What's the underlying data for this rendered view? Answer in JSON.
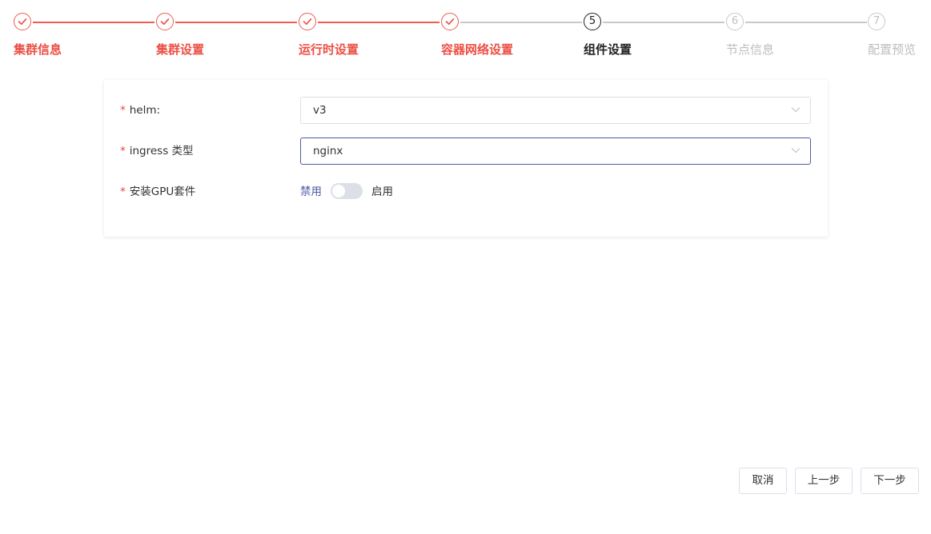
{
  "steps": [
    {
      "number": "1",
      "label": "集群信息",
      "state": "done"
    },
    {
      "number": "2",
      "label": "集群设置",
      "state": "done"
    },
    {
      "number": "3",
      "label": "运行时设置",
      "state": "done"
    },
    {
      "number": "4",
      "label": "容器网络设置",
      "state": "done"
    },
    {
      "number": "5",
      "label": "组件设置",
      "state": "active"
    },
    {
      "number": "6",
      "label": "节点信息",
      "state": "pending"
    },
    {
      "number": "7",
      "label": "配置预览",
      "state": "pending"
    }
  ],
  "form": {
    "required_mark": "*",
    "helm": {
      "label": "helm:",
      "value": "v3"
    },
    "ingress": {
      "label": "ingress 类型",
      "value": "nginx"
    },
    "gpu": {
      "label": "安装GPU套件",
      "off_text": "禁用",
      "on_text": "启用",
      "enabled": false
    }
  },
  "footer": {
    "cancel_label": "取消",
    "prev_label": "上一步",
    "next_label": "下一步"
  },
  "colors": {
    "accent_done": "#ec4f45",
    "active": "#222222",
    "pending": "#bcbcbc",
    "focus_border": "#4e5ba6",
    "switch_off_text": "#4e5ba6"
  },
  "icons": {
    "done_step": "check-icon",
    "select": "chevron-down-icon"
  }
}
